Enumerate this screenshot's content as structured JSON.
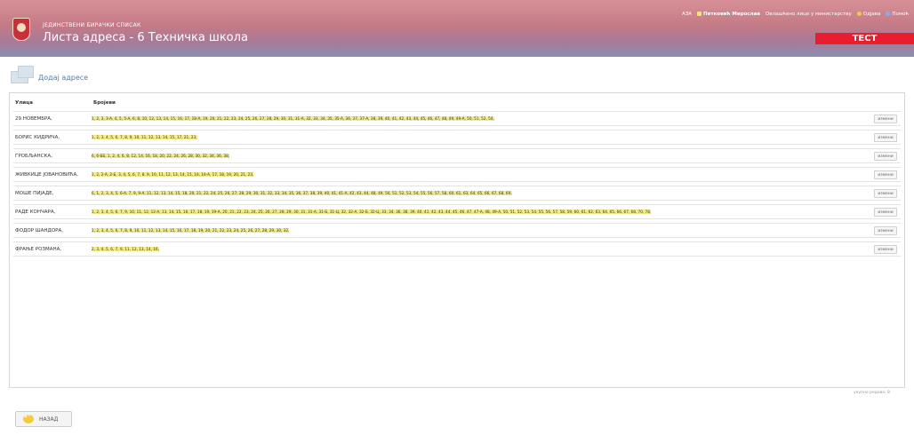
{
  "header": {
    "system_name": "ЈЕДИНСТВЕНИ БИРАЧКИ СПИСАК",
    "page_title": "Листа адреса - 6 Техничка школа",
    "nav": {
      "agency": "АЗА",
      "user": "Петковић Мирослав",
      "change_password": "Овлашћено лице у министарству",
      "logout": "Одјава",
      "help": "Помоћ"
    },
    "badge": "ТЕСТ"
  },
  "section": {
    "add_label": "Додај адресе"
  },
  "table": {
    "columns": [
      "Улица",
      "Бројеви"
    ],
    "rows": [
      {
        "street": "29.НОВЕМБРА,",
        "numbers": "1, 2, 3, 3-А, 4, 5, 5-А, 6, 8, 10, 12, 13, 14, 15, 16, 17, 18-А, 19, 20, 21, 22, 23, 24, 25, 26, 27, 28, 29, 30, 31, 31-А, 32, 33, 34, 35, 35-А, 36, 37, 37-А, 38, 39, 40, 41, 42, 43, 44, 45, 46, 47, 48, 49, 49-А, 50, 51, 52, 54,",
        "edit": "измени"
      },
      {
        "street": "БОРИС КИДРИЧА,",
        "numbers": "1, 2, 3, 4, 5, 6, 7, 8, 9, 10, 11, 12, 13, 14, 15, 17, 21, 23,",
        "edit": "измени"
      },
      {
        "street": "ГРОБЉАНСКА,",
        "numbers": "6, 6-ББ, 1, 2, 4, 6, 8, 12, 14, 16, 18, 20, 22, 24, 26, 28, 30, 32, 34, 36, 38,",
        "edit": "измени"
      },
      {
        "street": "ЖИВКИЦЕ ЈОВАНОВИЋА,",
        "numbers": "1, 2, 2-А, 2-Б, 3, 4, 5, 6, 7, 8, 9, 10, 11, 12, 13, 14, 15, 16, 16-А, 17, 18, 19, 20, 21, 23,",
        "edit": "измени"
      },
      {
        "street": "МОШЕ ПИЈАДЕ,",
        "numbers": "6, 1, 2, 3, 4, 5, 6-А, 7, 9, 9-А, 11, 12, 13, 14, 15, 18, 20, 21, 22, 24, 25, 26, 27, 28, 29, 30, 31, 32, 33, 34, 35, 36, 37, 38, 39, 40, 41, 41-А, 42, 43, 44, 48, 49, 50, 51, 52, 53, 54, 55, 56, 57, 58, 60, 61, 63, 64, 65, 66, 67, 68, 69,",
        "edit": "измени"
      },
      {
        "street": "РАДЕ КОНЧАРА,",
        "numbers": "1, 2, 3, 4, 5, 6, 7, 9, 10, 11, 12, 12-А, 13, 14, 15, 16, 17, 18, 19, 19-А, 20, 21, 22, 23, 24, 25, 26, 27, 28, 29, 30, 31, 31-А, 31-Б, 31-Ц, 32, 32-А, 32-Б, 32-Ц, 33, 34, 36, 38, 39, 40, 41, 42, 43, 44, 45, 46, 47, 47-А, 48, 49-А, 50, 51, 52, 53, 54, 55, 56, 57, 58, 59, 60, 61, 62, 63, 64, 65, 66, 67, 68, 70, 78,",
        "edit": "измени"
      },
      {
        "street": "ФОДОР ШАНДОРА,",
        "numbers": "1, 2, 3, 4, 5, 6, 7, 8, 9, 10, 11, 12, 13, 14, 15, 16, 17, 18, 19, 20, 21, 22, 23, 24, 25, 26, 27, 28, 29, 30, 32,",
        "edit": "измени"
      },
      {
        "street": "ФРАЊЕ РОЗМАНА,",
        "numbers": "2, 3, 4, 5, 6, 7, 9, 11, 12, 13, 14, 16,",
        "edit": "измени"
      }
    ]
  },
  "footer": {
    "note": "укупно редова: 8",
    "back_label": "НАЗАД"
  }
}
